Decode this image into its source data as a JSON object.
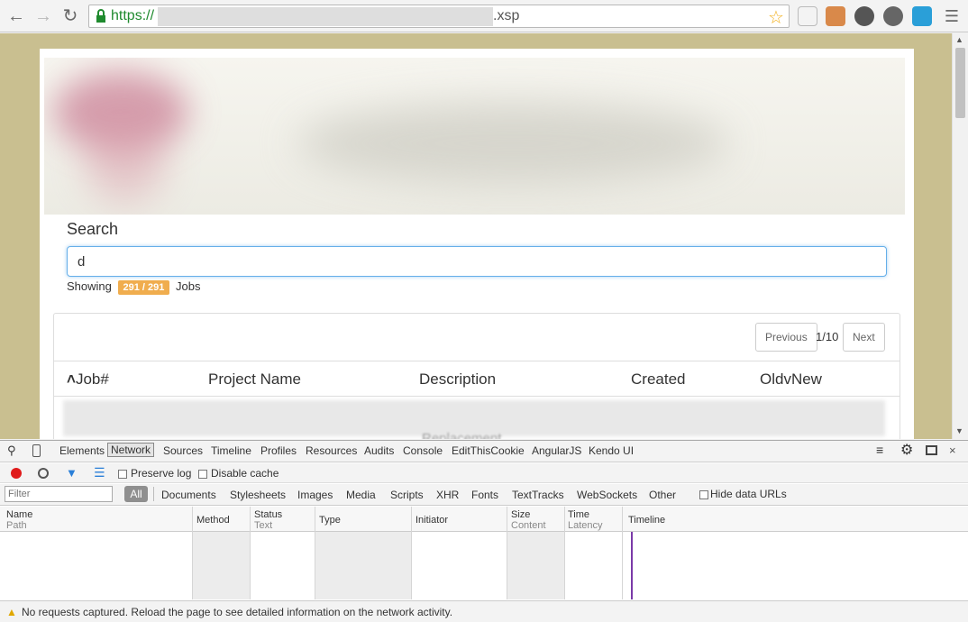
{
  "browser": {
    "url_prefix": "https://",
    "url_suffix": ".xsp"
  },
  "page": {
    "search_label": "Search",
    "search_value": "d",
    "showing_prefix": "Showing",
    "count_badge": "291 / 291",
    "showing_suffix": "Jobs",
    "pagination": {
      "previous": "Previous",
      "page_info": "1/10",
      "next": "Next"
    },
    "table_headers": [
      "Job#",
      "Project Name",
      "Description",
      "Created",
      "OldvNew"
    ],
    "sort_indicator": "^",
    "blurred_row_text": "Replacement"
  },
  "devtools": {
    "tabs": [
      "Elements",
      "Network",
      "Sources",
      "Timeline",
      "Profiles",
      "Resources",
      "Audits",
      "Console",
      "EditThisCookie",
      "AngularJS",
      "Kendo UI"
    ],
    "active_tab": "Network",
    "preserve_log": "Preserve log",
    "disable_cache": "Disable cache",
    "filter_placeholder": "Filter",
    "filter_all": "All",
    "type_filters": [
      "Documents",
      "Stylesheets",
      "Images",
      "Media",
      "Scripts",
      "XHR",
      "Fonts",
      "TextTracks",
      "WebSockets",
      "Other"
    ],
    "hide_data_urls": "Hide data URLs",
    "columns": [
      {
        "title": "Name",
        "sub": "Path"
      },
      {
        "title": "Method",
        "sub": ""
      },
      {
        "title": "Status",
        "sub": "Text"
      },
      {
        "title": "Type",
        "sub": ""
      },
      {
        "title": "Initiator",
        "sub": ""
      },
      {
        "title": "Size",
        "sub": "Content"
      },
      {
        "title": "Time",
        "sub": "Latency"
      },
      {
        "title": "Timeline",
        "sub": ""
      }
    ],
    "status_message": "No requests captured. Reload the page to see detailed information on the network activity."
  },
  "colors": {
    "accent": "#66afe9",
    "badge": "#f0ad4e",
    "page_background": "#c9bf90",
    "record_button": "#e01b1b",
    "timeline_marker": "#7a3aa8"
  },
  "icons": [
    "back-arrow-icon",
    "forward-arrow-icon",
    "reload-icon",
    "lock-icon",
    "star-icon",
    "extension-icons",
    "menu-icon",
    "search-icon",
    "device-icon",
    "record-icon",
    "clear-icon",
    "filter-icon",
    "list-icon",
    "gear-icon",
    "dock-icon",
    "close-icon",
    "warning-icon"
  ]
}
